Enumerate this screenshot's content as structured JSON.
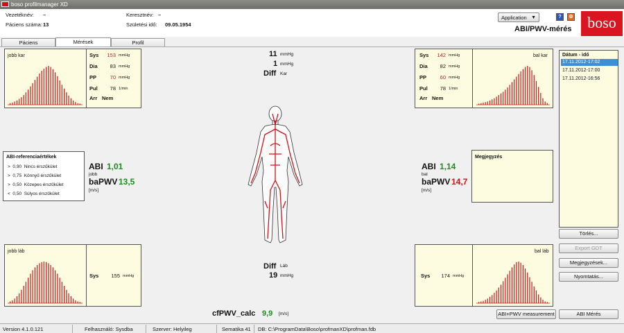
{
  "window": {
    "title": "boso profilmanager XD"
  },
  "header": {
    "surname_label": "Vezetéknév:",
    "surname_value": "–",
    "firstname_label": "Keresztnév:",
    "firstname_value": "–",
    "patient_no_label": "Páciens száma:",
    "patient_no_value": "13",
    "birth_label": "Születési idő:",
    "birth_value": "09.05.1954",
    "app_button": "Application",
    "help_icon": "?",
    "page_title": "ABI/PWV-mérés",
    "logo_text": "boso",
    "brand_color": "#d81520"
  },
  "tabs": [
    {
      "label": "Páciens",
      "active": false
    },
    {
      "label": "Mérések",
      "active": true
    },
    {
      "label": "Profil",
      "active": false
    }
  ],
  "right_arm": {
    "label": "jobb kar",
    "sys_label": "Sys",
    "sys": "153",
    "dia_label": "Dia",
    "dia": "83",
    "pp_label": "PP",
    "pp": "70",
    "pul_label": "Pul",
    "pul": "78",
    "arr_label": "Arr",
    "arr": "Nem",
    "unit_mmhg": "mmHg",
    "unit_pul": "1/min",
    "bars": [
      3,
      4,
      6,
      8,
      11,
      14,
      18,
      23,
      28,
      34,
      40,
      46,
      52,
      58,
      63,
      67,
      70,
      72,
      70,
      66,
      60,
      53,
      45,
      37,
      30,
      23,
      17,
      12,
      8,
      5,
      3,
      2
    ]
  },
  "left_arm": {
    "label": "bal kar",
    "sys_label": "Sys",
    "sys": "142",
    "dia_label": "Dia",
    "dia": "82",
    "pp_label": "PP",
    "pp": "60",
    "pul_label": "Pul",
    "pul": "78",
    "arr_label": "Arr",
    "arr": "Nem",
    "unit_mmhg": "mmHg",
    "unit_pul": "1/min",
    "bars": [
      2,
      3,
      4,
      5,
      6,
      8,
      10,
      12,
      15,
      18,
      21,
      24,
      28,
      32,
      37,
      42,
      47,
      52,
      57,
      62,
      66,
      70,
      72,
      70,
      64,
      55,
      44,
      33,
      22,
      12,
      6,
      3
    ]
  },
  "right_leg": {
    "label": "jobb láb",
    "sys_label": "Sys",
    "sys": "155",
    "unit_mmhg": "mmHg",
    "bars": [
      3,
      5,
      8,
      12,
      17,
      23,
      30,
      37,
      44,
      51,
      57,
      62,
      66,
      69,
      71,
      72,
      71,
      69,
      66,
      62,
      57,
      51,
      44,
      37,
      30,
      23,
      17,
      12,
      8,
      5,
      3,
      2
    ]
  },
  "left_leg": {
    "label": "bal láb",
    "sys_label": "Sys",
    "sys": "174",
    "unit_mmhg": "mmHg",
    "bars": [
      2,
      3,
      4,
      6,
      8,
      11,
      14,
      18,
      22,
      27,
      32,
      38,
      44,
      50,
      56,
      62,
      67,
      71,
      72,
      70,
      66,
      60,
      53,
      45,
      37,
      29,
      22,
      15,
      10,
      6,
      3,
      2
    ]
  },
  "center": {
    "arm_diff_top": "11",
    "arm_diff_top_unit": "mmHg",
    "arm_diff_mid": "1",
    "arm_diff_mid_unit": "mmHg",
    "arm_diff_label": "Diff",
    "arm_diff_sub": "Kar",
    "leg_diff_label": "Diff",
    "leg_diff_sub": "Láb",
    "leg_diff_value": "19",
    "leg_diff_unit": "mmHg"
  },
  "abi_right": {
    "abi_label": "ABI",
    "abi_value": "1,01",
    "side": "jobb",
    "pwv_label": "baPWV",
    "pwv_value": "13,5",
    "pwv_unit": "[m/s]",
    "abi_color": "#1e8a1e",
    "pwv_color": "#1e8a1e"
  },
  "abi_left": {
    "abi_label": "ABI",
    "abi_value": "1,14",
    "side": "bal",
    "pwv_label": "baPWV",
    "pwv_value": "14,7",
    "pwv_unit": "[m/s]",
    "abi_color": "#1e8a1e",
    "pwv_color": "#d01018"
  },
  "reference": {
    "title": "ABI-referenciaértékek",
    "rows": [
      {
        "op": ">",
        "val": "0,90",
        "text": "Nincs érszűkület"
      },
      {
        "op": ">",
        "val": "0,75",
        "text": "Könnyű érszűkület"
      },
      {
        "op": ">",
        "val": "0,50",
        "text": "Közepes érszűkület"
      },
      {
        "op": "<",
        "val": "0,50",
        "text": "Súlyos érszűkület"
      }
    ]
  },
  "note": {
    "title": "Megjegyzés"
  },
  "dates": {
    "title": "Dátum - idő",
    "items": [
      "17.11.2012-17:02",
      "17.11.2012-17:00",
      "17.11.2012-16:56"
    ],
    "selected": 0
  },
  "buttons": {
    "delete": "Törlés...",
    "export": "Export GDT",
    "notes": "Megjegyzések...",
    "print": "Nyomtatás...",
    "abi_pwv": "ABI+PWV measurement",
    "abi_measure": "ABI Mérés"
  },
  "cfpwv": {
    "label": "cfPWV_calc",
    "value": "9,9",
    "unit": "[m/s]"
  },
  "status": {
    "version": "Version 4.1.0.121",
    "user": "Felhasználó: Sysdba",
    "server": "Szerver: Helyileg",
    "schema": "Sematika 41",
    "db": "DB: C:\\ProgramData\\Boso\\profmanXD\\profman.fdb"
  }
}
